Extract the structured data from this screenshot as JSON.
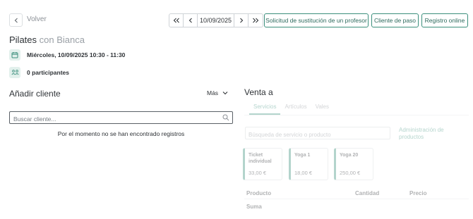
{
  "nav": {
    "back_label": "Volver",
    "date": "10/09/2025"
  },
  "toolbar": {
    "substitution_label": "Solicitud de sustitución de un profesor",
    "walkin_label": "Cliente de paso",
    "online_label": "Registro online"
  },
  "session": {
    "class_name": "Pilates",
    "instructor": "con Bianca",
    "datetime": "Miércoles, 10/09/2025 10:30 - 11:30",
    "participants": "0 participantes"
  },
  "add_client": {
    "heading": "Añadir cliente",
    "more_label": "Más",
    "search_placeholder": "Buscar cliente...",
    "empty_message": "Por el momento no se han encontrado registros"
  },
  "sale": {
    "heading": "Venta a",
    "tabs": [
      {
        "label": "Servicios",
        "active": true
      },
      {
        "label": "Artículos",
        "active": false
      },
      {
        "label": "Vales",
        "active": false
      }
    ],
    "search_placeholder": "Búsqueda de servicio o producto",
    "admin_link": "Administración de productos",
    "products": [
      {
        "name": "Ticket individual",
        "price": "33,00 €"
      },
      {
        "name": "Yoga 1",
        "price": "18,00 €"
      },
      {
        "name": "Yoga 20",
        "price": "250,00 €"
      }
    ],
    "table": {
      "col_product": "Producto",
      "col_quantity": "Cantidad",
      "col_price": "Precio",
      "total_label": "Suma"
    }
  },
  "icons": {
    "back": "chevron-left-icon",
    "first": "double-chevron-left-icon",
    "prev": "chevron-left-icon",
    "next": "chevron-right-icon",
    "last": "double-chevron-right-icon",
    "calendar": "calendar-icon",
    "participants": "group-icon",
    "dropdown": "chevron-down-icon",
    "search": "search-icon"
  },
  "colors": {
    "accent": "#3b8f7c",
    "icon_bg": "#e2f0ec"
  }
}
